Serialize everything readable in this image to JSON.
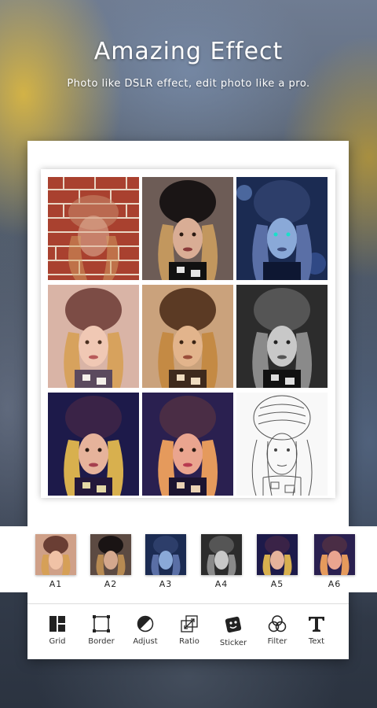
{
  "header": {
    "title": "Amazing Effect",
    "subtitle": "Photo like DSLR effect, edit photo like a pro."
  },
  "collage": {
    "cells": [
      {
        "effect": "brick-wall"
      },
      {
        "effect": "dark-contrast"
      },
      {
        "effect": "blue-night"
      },
      {
        "effect": "warm-pastel"
      },
      {
        "effect": "sepia"
      },
      {
        "effect": "black-white"
      },
      {
        "effect": "purple-tone"
      },
      {
        "effect": "vivid-purple"
      },
      {
        "effect": "pencil-sketch"
      }
    ]
  },
  "thumbnails": [
    {
      "label": "A1"
    },
    {
      "label": "A2"
    },
    {
      "label": "A3"
    },
    {
      "label": "A4"
    },
    {
      "label": "A5"
    },
    {
      "label": "A6"
    }
  ],
  "toolbar": {
    "tools": [
      {
        "label": "Grid",
        "icon": "grid-icon"
      },
      {
        "label": "Border",
        "icon": "border-icon"
      },
      {
        "label": "Adjust",
        "icon": "adjust-icon"
      },
      {
        "label": "Ratio",
        "icon": "ratio-icon"
      },
      {
        "label": "Sticker",
        "icon": "sticker-icon"
      },
      {
        "label": "Filter",
        "icon": "filter-icon"
      },
      {
        "label": "Text",
        "icon": "text-icon"
      }
    ]
  }
}
